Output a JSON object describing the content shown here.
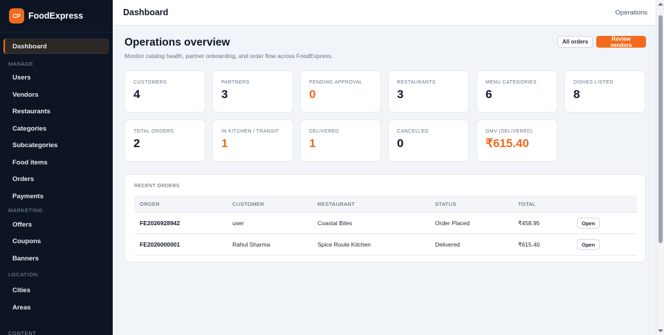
{
  "brand": {
    "logo_text": "CP",
    "name": "FoodExpress",
    "accent": "#f26b1d"
  },
  "sidebar": {
    "dashboard": "Dashboard",
    "sections": {
      "manage": "MANAGE",
      "marketing": "MARKETING",
      "location": "LOCATION",
      "content": "CONTENT"
    },
    "items": {
      "users": "Users",
      "vendors": "Vendors",
      "restaurants": "Restaurants",
      "categories": "Categories",
      "subcategories": "Subcategories",
      "food_items": "Food items",
      "orders": "Orders",
      "payments": "Payments",
      "offers": "Offers",
      "coupons": "Coupons",
      "banners": "Banners",
      "cities": "Cities",
      "areas": "Areas"
    }
  },
  "topbar": {
    "title": "Dashboard",
    "right": "Operations"
  },
  "overview": {
    "title": "Operations overview",
    "subtitle": "Monitor catalog health, partner onboarding, and order flow across FoodExpress.",
    "all_orders": "All orders",
    "review_vendors": "Review vendors"
  },
  "stats": {
    "customers": {
      "label": "CUSTOMERS",
      "value": "4"
    },
    "partners": {
      "label": "PARTNERS",
      "value": "3"
    },
    "pending": {
      "label": "PENDING APPROVAL",
      "value": "0"
    },
    "restaurants": {
      "label": "RESTAURANTS",
      "value": "3"
    },
    "menu_categories": {
      "label": "MENU CATEGORIES",
      "value": "6"
    },
    "dishes": {
      "label": "DISHES LISTED",
      "value": "8"
    },
    "total_orders": {
      "label": "TOTAL ORDERS",
      "value": "2"
    },
    "in_kitchen": {
      "label": "IN KITCHEN / TRANSIT",
      "value": "1"
    },
    "delivered": {
      "label": "DELIVERED",
      "value": "1"
    },
    "cancelled": {
      "label": "CANCELLED",
      "value": "0"
    },
    "gmv": {
      "label": "GMV (DELIVERED)",
      "value": "₹615.40"
    }
  },
  "recent_orders": {
    "title": "RECENT ORDERS",
    "headers": {
      "order": "ORDER",
      "customer": "CUSTOMER",
      "restaurant": "RESTAURANT",
      "status": "STATUS",
      "total": "TOTAL"
    },
    "rows": [
      {
        "order": "FE2026928942",
        "customer": "user",
        "restaurant": "Coastal Bites",
        "status": "Order Placed",
        "total": "₹458.95",
        "action": "Open"
      },
      {
        "order": "FE2026000001",
        "customer": "Rahul Sharma",
        "restaurant": "Spice Route Kitchen",
        "status": "Delivered",
        "total": "₹615.40",
        "action": "Open"
      }
    ]
  }
}
